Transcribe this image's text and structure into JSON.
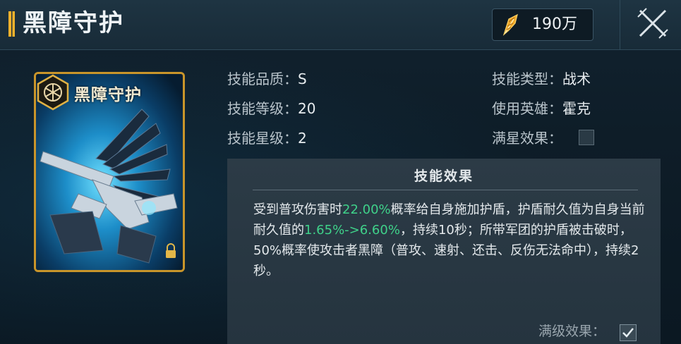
{
  "header": {
    "title": "黑障守护",
    "currency_value": "190万",
    "currency_icon": "gold-feather-icon",
    "close_icon": "close-icon"
  },
  "card": {
    "title": "黑障守护",
    "badge_icon": "hex-emblem-icon",
    "lock_icon": "lock-icon"
  },
  "info": {
    "quality_label": "技能品质：",
    "quality_value": "S",
    "level_label": "技能等级：",
    "level_value": "20",
    "star_label": "技能星级：",
    "star_value": "2",
    "type_label": "技能类型：",
    "type_value": "战术",
    "hero_label": "使用英雄：",
    "hero_value": "霍克",
    "fullstar_label": "满星效果：",
    "fullstar_checked": false
  },
  "effect": {
    "title": "技能效果",
    "t1": "受到普攻伤害时",
    "h1": "22.00%",
    "t2": "概率给自身施加护盾，护盾耐久值为自身当前耐久值的",
    "h2": "1.65%->6.60%",
    "t3": "，持续10秒；所带军团的护盾被击破时，50%概率使攻击者黑障（普攻、速射、还击、反伤无法命中），持续2秒。",
    "highlight_color": "#3fd28a",
    "maxlevel_label": "满级效果：",
    "maxlevel_checked": true
  }
}
